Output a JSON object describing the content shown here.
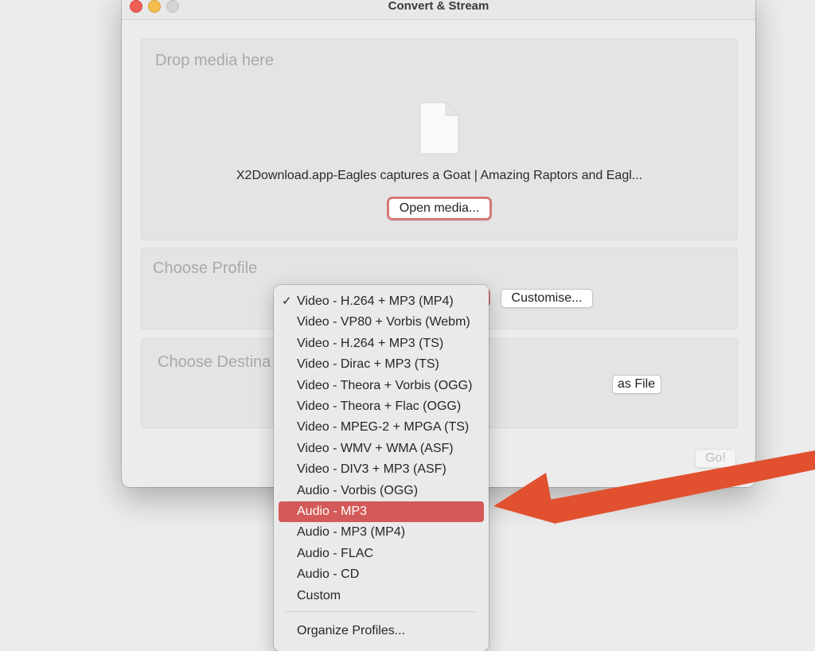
{
  "window": {
    "title": "Convert & Stream"
  },
  "drop": {
    "panel_title": "Drop media here",
    "filename": "X2Download.app-Eagles captures a Goat | Amazing Raptors and Eagl...",
    "open_button": "Open media..."
  },
  "profile": {
    "panel_title": "Choose Profile",
    "customise_button": "Customise..."
  },
  "destination": {
    "panel_title": "Choose Destina",
    "save_button": "as File"
  },
  "go_button": "Go!",
  "menu": {
    "items": [
      {
        "label": "Video - H.264 + MP3 (MP4)",
        "checked": true
      },
      {
        "label": "Video - VP80 + Vorbis (Webm)"
      },
      {
        "label": "Video - H.264 + MP3 (TS)"
      },
      {
        "label": "Video - Dirac + MP3 (TS)"
      },
      {
        "label": "Video - Theora + Vorbis (OGG)"
      },
      {
        "label": "Video - Theora + Flac (OGG)"
      },
      {
        "label": "Video - MPEG-2 + MPGA (TS)"
      },
      {
        "label": "Video - WMV + WMA (ASF)"
      },
      {
        "label": "Video - DIV3 + MP3 (ASF)"
      },
      {
        "label": "Audio - Vorbis (OGG)"
      },
      {
        "label": "Audio - MP3",
        "highlighted": true
      },
      {
        "label": "Audio - MP3 (MP4)"
      },
      {
        "label": "Audio - FLAC"
      },
      {
        "label": "Audio - CD"
      },
      {
        "label": "Custom"
      }
    ],
    "footer_item": "Organize Profiles...",
    "check_glyph": "✓"
  },
  "colors": {
    "highlight": "#d35a58",
    "arrow": "#e1502f",
    "close": "#ee5f57",
    "minimize": "#f5be4f"
  }
}
